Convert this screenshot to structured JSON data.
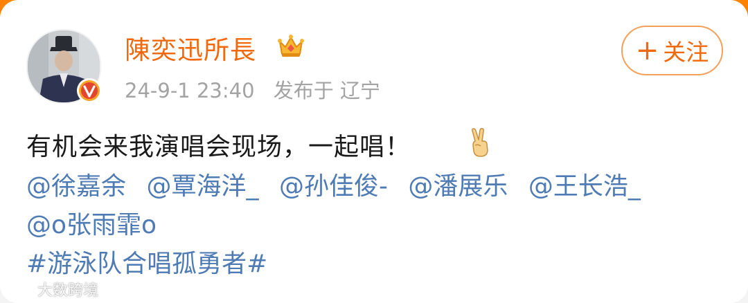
{
  "post": {
    "author": {
      "name": "陳奕迅所長",
      "verified_badge": "V"
    },
    "timestamp": "24-9-1 23:40",
    "source": "发布于 辽宁",
    "follow_label": "关注",
    "follow_plus": "+",
    "body": "有机会来我演唱会现场，一起唱！",
    "emoji": "victory-hand-emoji",
    "mentions_line1": [
      "@徐嘉余",
      "@覃海洋_",
      "@孙佳俊-",
      "@潘展乐",
      "@王长浩_"
    ],
    "mentions_line2": [
      "@o张雨霏o"
    ],
    "hashtag": "#游泳队合唱孤勇者#"
  },
  "watermark": "大数跨境",
  "colors": {
    "username": "#f2690d",
    "link": "#4f7bb5",
    "meta": "#a3a3a3",
    "accent": "#ff8200"
  }
}
